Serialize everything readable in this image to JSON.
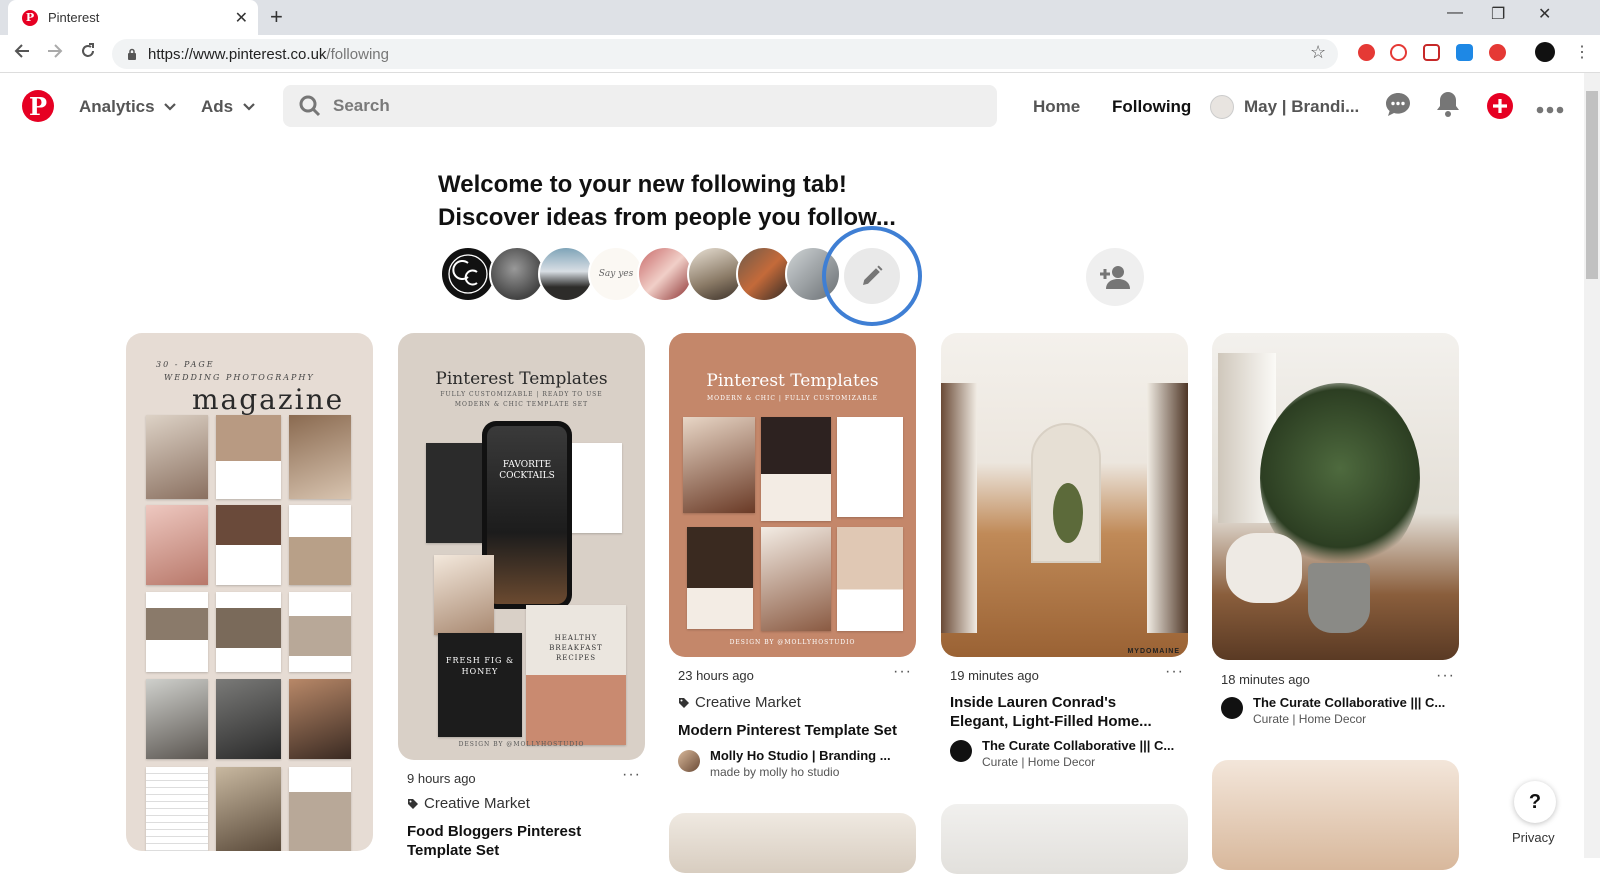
{
  "browser": {
    "tab_title": "Pinterest",
    "tab_close": "✕",
    "new_tab": "+",
    "url_host": "https://www.pinterest.co.uk",
    "url_path": "/following",
    "window_controls": [
      "—",
      "❐",
      "✕"
    ]
  },
  "header": {
    "menus": [
      {
        "label": "Analytics"
      },
      {
        "label": "Ads"
      }
    ],
    "search_placeholder": "Search",
    "nav": {
      "home": "Home",
      "following": "Following",
      "profile": "May | Brandi..."
    }
  },
  "welcome": {
    "line1": "Welcome to your new following tab!",
    "line2": "Discover ideas from people you follow..."
  },
  "pins": [
    {
      "id": "wedding-magazine",
      "image_text": {
        "small": "30 - PAGE",
        "sub": "WEDDING PHOTOGRAPHY",
        "big": "magazine"
      }
    },
    {
      "id": "food-bloggers",
      "image_text": {
        "title": "Pinterest Templates",
        "sub": "FULLY CUSTOMIZABLE | READY TO USE",
        "sub2": "MODERN & CHIC TEMPLATE SET",
        "phone": "FAVORITE COCKTAILS",
        "card": "FRESH FIG & HONEY",
        "card2": "HEALTHY BREAKFAST RECIPES",
        "credit": "DESIGN BY @MOLLYHOSTUDIO"
      },
      "time": "9 hours ago",
      "board": "Creative Market",
      "title": "Food Bloggers Pinterest Template Set"
    },
    {
      "id": "modern-template",
      "image_text": {
        "title": "Pinterest Templates",
        "sub": "MODERN & CHIC | FULLY CUSTOMIZABLE",
        "credit": "DESIGN BY @MOLLYHOSTUDIO"
      },
      "time": "23 hours ago",
      "board": "Creative Market",
      "title": "Modern Pinterest Template Set",
      "pinner_name": "Molly Ho Studio | Branding ...",
      "pinner_sub": "made by molly ho studio"
    },
    {
      "id": "lauren-conrad",
      "image_text": {
        "watermark": "MYDOMAINE"
      },
      "time": "19 minutes ago",
      "title": "Inside Lauren Conrad's Elegant, Light-Filled Home...",
      "pinner_name": "The Curate Collaborative ||| C...",
      "pinner_sub": "Curate | Home Decor"
    },
    {
      "id": "monstera",
      "time": "18 minutes ago",
      "pinner_name": "The Curate Collaborative ||| C...",
      "pinner_sub": "Curate | Home Decor"
    }
  ],
  "more_glyph": "···",
  "help": "?",
  "privacy": "Privacy",
  "colors": {
    "brand": "#e60023",
    "highlight_ring": "#3f7fd4"
  }
}
